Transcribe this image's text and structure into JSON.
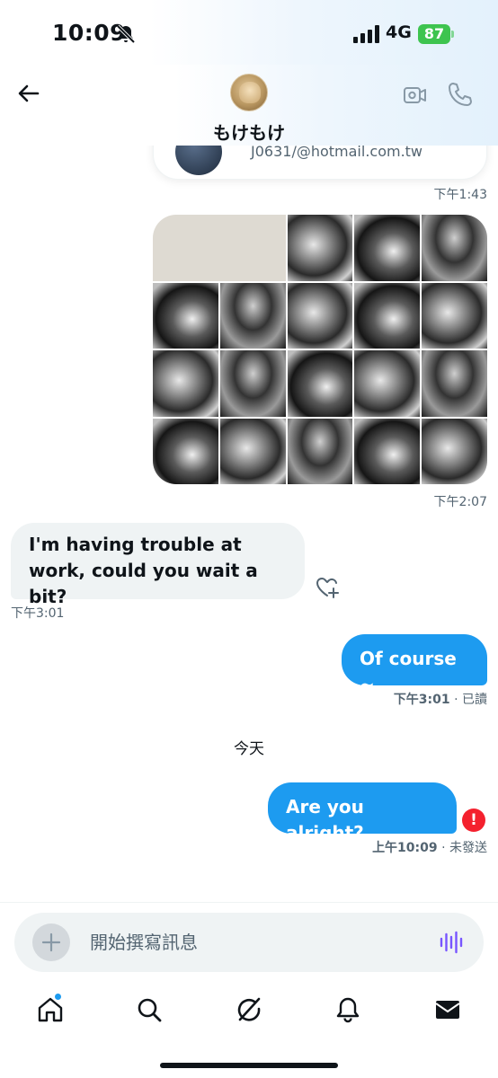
{
  "status_bar": {
    "time": "10:09",
    "network": "4G",
    "battery": "87"
  },
  "header": {
    "contact_name": "もけもけ"
  },
  "conversation": {
    "shared_card": {
      "email": "J0631/@hotmail.com.tw",
      "timestamp": "下午1:43"
    },
    "image_grid_timestamp": "下午2:07",
    "messages": [
      {
        "direction": "incoming",
        "text": "I'm having trouble at work, could you wait a bit?",
        "timestamp": "下午3:01"
      },
      {
        "direction": "outgoing",
        "text": "Of course ~",
        "timestamp": "下午3:01",
        "status": "· 已讀"
      },
      {
        "direction": "outgoing",
        "text": "Are you alright?",
        "timestamp": "上午10:09",
        "status": "· 未發送"
      }
    ],
    "day_divider": "今天",
    "error_glyph": "!"
  },
  "composer": {
    "placeholder": "開始撰寫訊息"
  },
  "tab_bar": {
    "items": [
      "home-icon",
      "search-icon",
      "grok-icon",
      "bell-icon",
      "mail-icon"
    ]
  },
  "colors": {
    "accent": "#1d9bf0",
    "error": "#f4212e",
    "battery": "#3ec44f",
    "incoming_bubble": "#eff3f4",
    "voice_icon": "#7856ff"
  }
}
